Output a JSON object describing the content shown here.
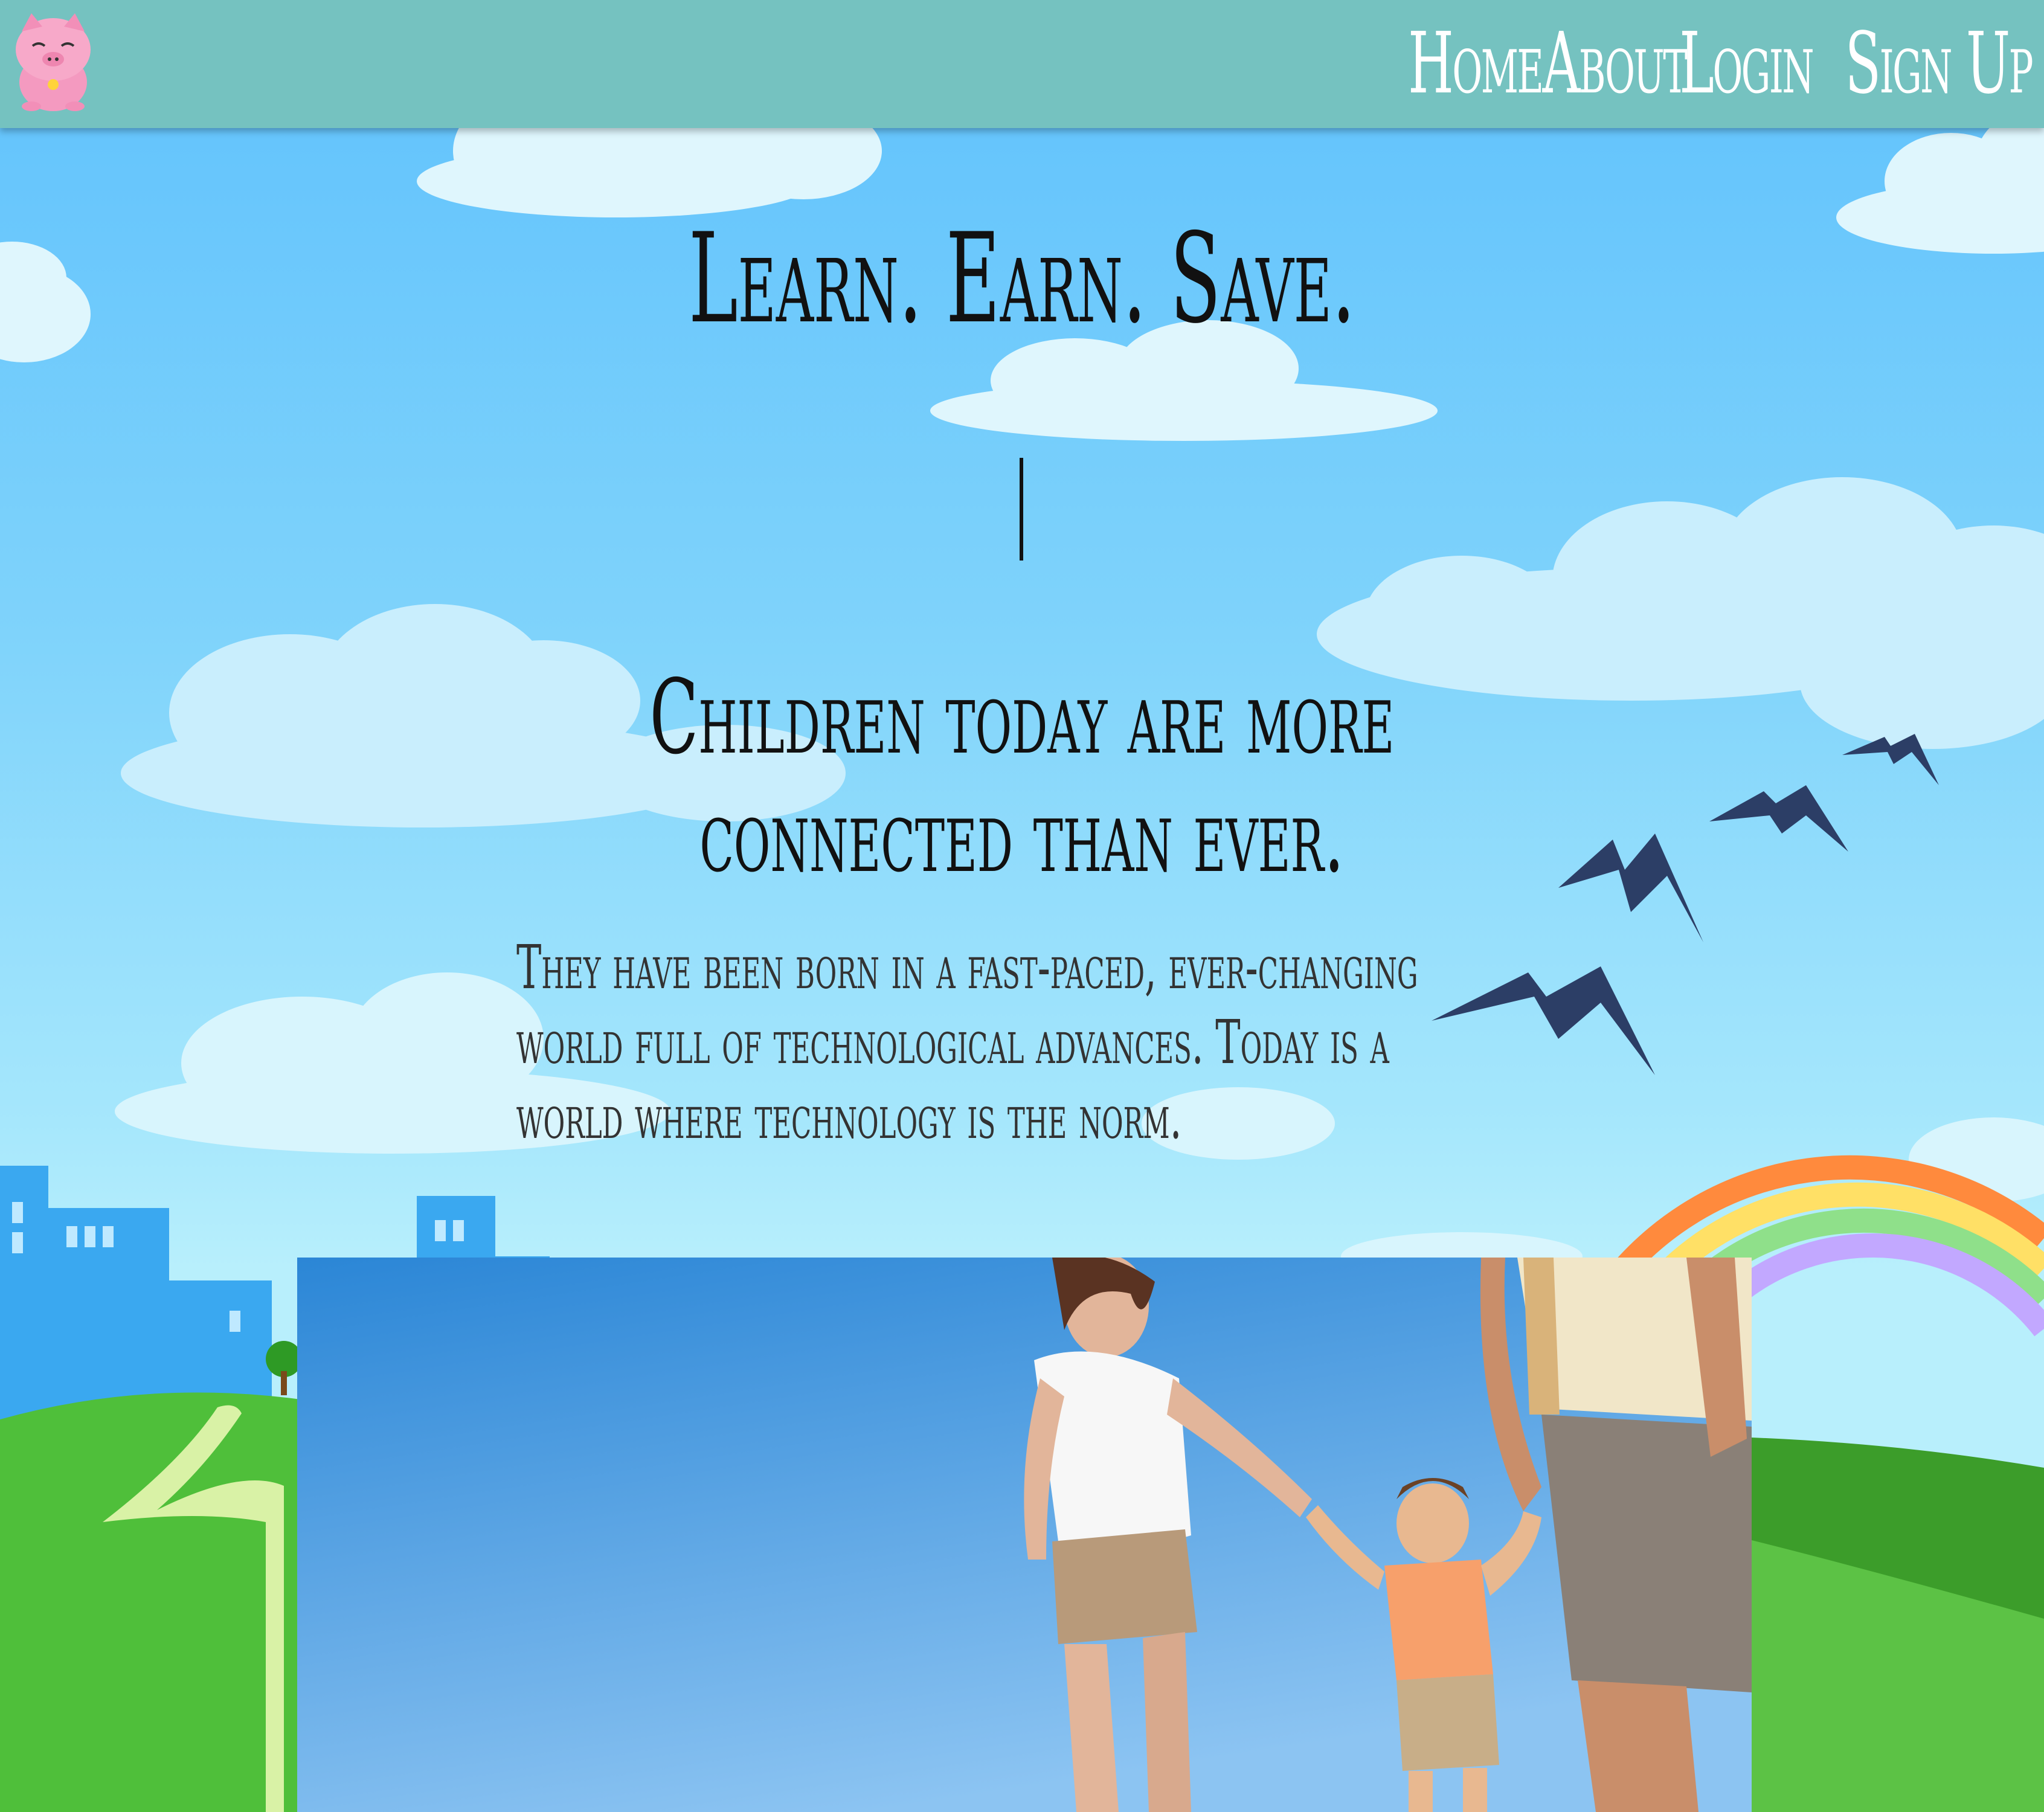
{
  "nav": {
    "links": [
      {
        "label": "Home"
      },
      {
        "label": "About"
      },
      {
        "label": "Login"
      },
      {
        "label": "Sign Up"
      }
    ]
  },
  "hero": {
    "title": "Learn. Earn. Save.",
    "subtitle_line1": "Children today are more",
    "subtitle_line2": "connected than ever.",
    "body_line1": "They have been born in a fast-paced, ever-changing",
    "body_line2": "world full of technological advances. Today is a",
    "body_line3": "world where technology is the norm."
  },
  "icons": {
    "logo": "piggy-bank-logo-icon"
  },
  "colors": {
    "nav_bg": "#75c2c0",
    "sky_top": "#5fc1fc",
    "sky_bottom": "#b8effc",
    "text": "#111111",
    "bird": "#2c3e66",
    "grass": "#4fbf3a"
  }
}
